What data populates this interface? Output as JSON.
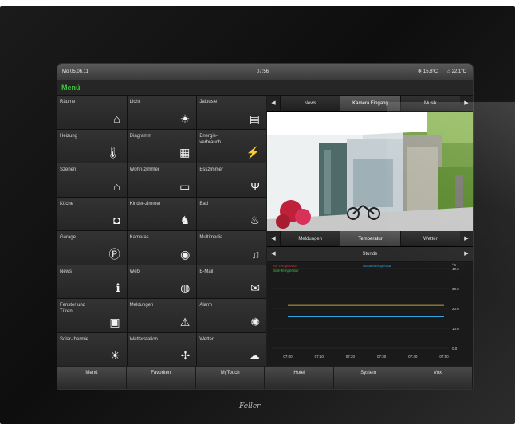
{
  "status_bar": {
    "date": "Mo 05.06.11",
    "time": "07:56",
    "temp_out": "15.8°C",
    "temp_in": "22.1°C"
  },
  "menu_title": "Menü",
  "tiles": [
    {
      "label": "Räume",
      "icon": "house-icon",
      "glyph": "⌂"
    },
    {
      "label": "Licht",
      "icon": "light-icon",
      "glyph": "☀"
    },
    {
      "label": "Jalousie",
      "icon": "blinds-icon",
      "glyph": "▤"
    },
    {
      "label": "Heizung",
      "icon": "thermometer-icon",
      "glyph": "🌡"
    },
    {
      "label": "Diagramm",
      "icon": "chart-icon",
      "glyph": "▦"
    },
    {
      "label": "Energie-verbrauch",
      "icon": "plug-icon",
      "glyph": "⚡"
    },
    {
      "label": "Szenen",
      "icon": "scene-icon",
      "glyph": "⌂"
    },
    {
      "label": "Wohn-zimmer",
      "icon": "sofa-icon",
      "glyph": "▭"
    },
    {
      "label": "Esszimmer",
      "icon": "cutlery-icon",
      "glyph": "Ψ"
    },
    {
      "label": "Küche",
      "icon": "pot-icon",
      "glyph": "◘"
    },
    {
      "label": "Kinder-zimmer",
      "icon": "toy-icon",
      "glyph": "♞"
    },
    {
      "label": "Bad",
      "icon": "shower-icon",
      "glyph": "♨"
    },
    {
      "label": "Garage",
      "icon": "parking-icon",
      "glyph": "Ⓟ"
    },
    {
      "label": "Kameras",
      "icon": "eye-icon",
      "glyph": "◉"
    },
    {
      "label": "Multimedia",
      "icon": "music-icon",
      "glyph": "♫"
    },
    {
      "label": "News",
      "icon": "info-icon",
      "glyph": "ℹ"
    },
    {
      "label": "Web",
      "icon": "globe-icon",
      "glyph": "◍"
    },
    {
      "label": "E-Mail",
      "icon": "mail-icon",
      "glyph": "✉"
    },
    {
      "label": "Fenster und Türen",
      "icon": "lock-icon",
      "glyph": "▣"
    },
    {
      "label": "Meldungen",
      "icon": "warning-icon",
      "glyph": "⚠"
    },
    {
      "label": "Alarm",
      "icon": "alarm-icon",
      "glyph": "✺"
    },
    {
      "label": "Solar-thermie",
      "icon": "solar-icon",
      "glyph": "☀"
    },
    {
      "label": "Wetterstation",
      "icon": "weather-station-icon",
      "glyph": "✢"
    },
    {
      "label": "Wetter",
      "icon": "cloud-sun-icon",
      "glyph": "☁"
    }
  ],
  "top_tabs": [
    "News",
    "Kamera Eingang",
    "Musik"
  ],
  "chart_tabs": [
    "Meldungen",
    "Temperatur",
    "Wetter"
  ],
  "chart_range_title": "Stunde",
  "bottom_nav": [
    "Menü",
    "Favoriten",
    "MyTouch",
    "Hotel",
    "System",
    "Vox"
  ],
  "brand": "Feller",
  "chart_data": {
    "type": "line",
    "x": [
      "07:00",
      "07:10",
      "07:20",
      "07:30",
      "07:40",
      "07:50"
    ],
    "series": [
      {
        "name": "Ist-Temperatur",
        "color": "#e0312f",
        "values": [
          22.1,
          22.1,
          22.1,
          22.1,
          22.1,
          22.1
        ]
      },
      {
        "name": "Soll-Temperatur",
        "color": "#3ec43e",
        "values": [
          21.5,
          21.5,
          21.5,
          21.5,
          21.5,
          21.5
        ]
      },
      {
        "name": "Aussentemperatur",
        "color": "#2fa6e0",
        "values": [
          15.8,
          15.8,
          15.8,
          15.8,
          15.8,
          15.8
        ]
      }
    ],
    "ylabel": "°C",
    "yticks": [
      "40.0",
      "30.0",
      "20.0",
      "10.0",
      "0.0"
    ],
    "ylim": [
      0,
      40
    ]
  }
}
